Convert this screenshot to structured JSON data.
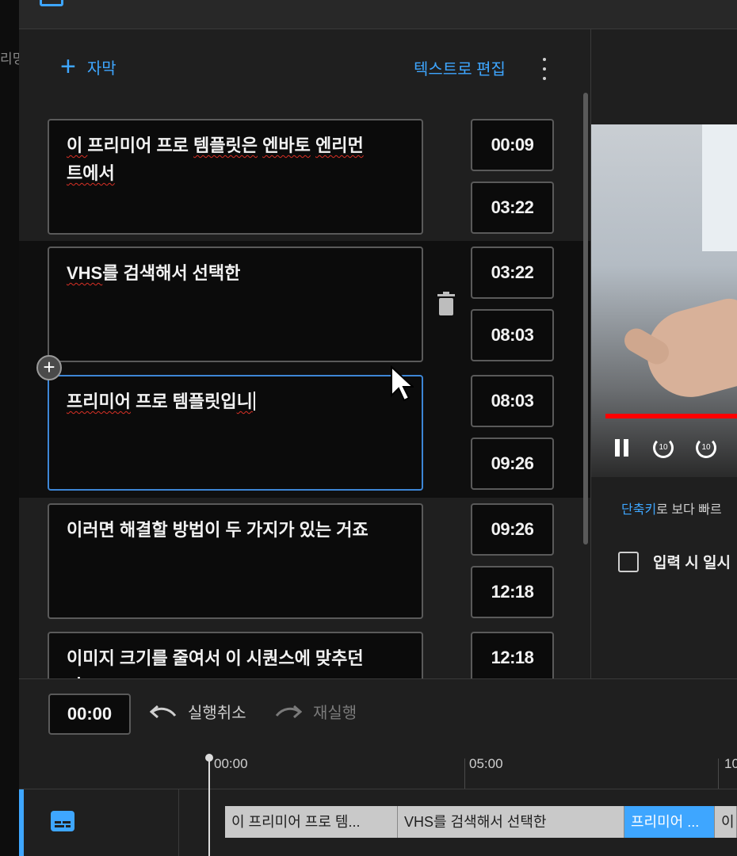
{
  "header": {
    "title_fragment": ""
  },
  "left_strip": {
    "fragment": "리밍"
  },
  "editor": {
    "add_label": "자막",
    "edit_as_text_label": "텍스트로 편집",
    "cues": [
      {
        "text_parts": [
          "이 ",
          "프리미어",
          " 프로 ",
          "템플릿은",
          " ",
          "엔바토",
          " ",
          "엔리먼",
          "\n",
          "트에서"
        ],
        "squiggle": [
          1,
          4,
          6,
          8,
          10
        ],
        "start": "00:09",
        "end": "03:22"
      },
      {
        "text_parts": [
          "VHS",
          "를",
          " 검색해서 선택한"
        ],
        "squiggle": [
          1
        ],
        "start": "03:22",
        "end": "08:03"
      },
      {
        "text_parts": [
          "프리미어",
          " 프로 템플릿입",
          "니"
        ],
        "squiggle": [
          1,
          3
        ],
        "start": "08:03",
        "end": "09:26"
      },
      {
        "text_parts": [
          " 이러면 해결할 방법이 두 가지가 있는 거죠"
        ],
        "squiggle": [],
        "start": "09:26",
        "end": "12:18"
      },
      {
        "text_parts": [
          "이미지 크기를 줄여서 이 시퀀스에 맞추던",
          "\n",
          "가"
        ],
        "squiggle": [],
        "start": "12:18",
        "end": ""
      }
    ]
  },
  "preview": {
    "shortcut_link": "단축키",
    "shortcut_rest": "로 보다 빠르",
    "pause_option_label": "입력 시 일시"
  },
  "timeline": {
    "current_time": "00:00",
    "undo_label": "실행취소",
    "redo_label": "재실행",
    "ticks": [
      "00:00",
      "05:00",
      "10"
    ],
    "segments": [
      {
        "label": "이 프리미어 프로 템...",
        "active": false
      },
      {
        "label": "VHS를 검색해서 선택한",
        "active": false
      },
      {
        "label": "프리미어 ...",
        "active": true
      },
      {
        "label": "이",
        "active": false
      }
    ]
  },
  "colors": {
    "accent": "#3ea6ff",
    "progress": "#ff0000",
    "spell_error": "#d93025"
  }
}
